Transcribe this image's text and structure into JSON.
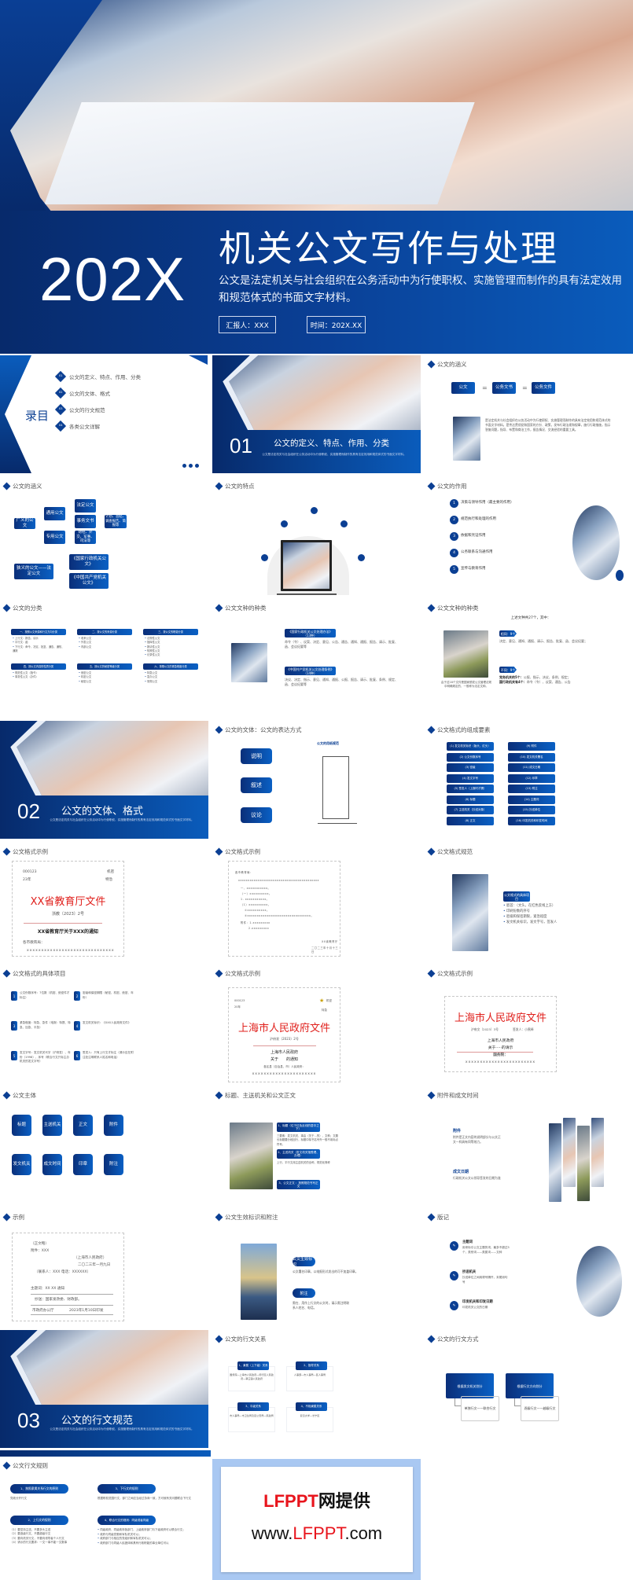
{
  "hero": {
    "year": "202X",
    "title": "机关公文写作与处理",
    "desc": "公文是法定机关与社会组织在公务活动中为行使职权、实施管理而制作的具有法定效用和规范体式的书面文字材料。",
    "reporter": "汇报人：XXX",
    "time": "时间：202X.XX"
  },
  "s": {
    "1": {
      "title": "录目",
      "items": [
        {
          "n": "01",
          "t": "公文的定义、特点、作用、分类"
        },
        {
          "n": "02",
          "t": "公文的文体、格式"
        },
        {
          "n": "03",
          "t": "公文的行文规范"
        },
        {
          "n": "04",
          "t": "各类公文详解"
        }
      ]
    },
    "2": {
      "num": "01",
      "title": "公文的定义、特点、作用、分类",
      "desc": "公文是法定机关与社会组织在公务活动中为行使职权、实施管理而制作的具有法定效用和规范体式的书面文字材料。"
    },
    "3": {
      "hd": "公文的涵义",
      "eq": [
        "公文",
        "公务文书",
        "公务文件"
      ],
      "sign": "=",
      "para": "是法定机关与社会组织在公务活动中为行使职权、实施管理而制作的具有法定效用和规范体式的书面文字材料。是传达贯彻党和国家的方针、政策，发布行政法规和规章，施行行政措施，指示答复问题，指导、布置和商洽工作，报告情况、交流经验的重要工具。"
    },
    "4": {
      "hd": "公文的涵义",
      "b": [
        "广义的公文",
        "通用公文",
        "专用公文",
        "法定公文",
        "事务文书",
        "财经、外交、军事、司法等",
        "计划、总结、调查报告、简报等",
        "狭义的公文——法定公文",
        "《国家行政机关公文》",
        "《中国共产党机关公文》"
      ]
    },
    "5": {
      "hd": "公文的特点"
    },
    "6": {
      "hd": "公文的作用",
      "items": [
        "决策与领导作用（最主要的作用）",
        "规范执行和处理的作用",
        "依据和凭证作用",
        "公务联系与沟通作用",
        "宣传与教育作用"
      ]
    },
    "7": {
      "hd": "公文的分类",
      "g": [
        {
          "t": "一、按照公文来源和行文方向分类",
          "i": [
            "上行文：报告、请示",
            "平行文：函",
            "下行文：命令、决定、批复、通告、通知、通报"
          ]
        },
        {
          "t": "二、按公文的来源分类",
          "i": [
            "收来公文",
            "外发公文",
            "内部公文"
          ]
        },
        {
          "t": "三、按公文的职能分类",
          "i": [
            "法规性公文",
            "指挥性公文",
            "报请性公文",
            "知照性公文",
            "记录性公文"
          ]
        },
        {
          "t": "四、按公文内容的性质分类",
          "i": [
            "规范性公文（指令）",
            "事务性公文（办件）"
          ]
        },
        {
          "t": "五、按公文的秘密等级分类",
          "i": [
            "绝密公文",
            "机密公文",
            "秘密公文"
          ]
        },
        {
          "t": "六、按照公文的紧急程度分类",
          "i": [
            "特急公文",
            "急办公文",
            "常规公文"
          ]
        }
      ]
    },
    "8": {
      "hd": "公文文种的种类",
      "a": "《国家行政机关公文处理办法》（13种）",
      "at": "命令（令）、议案、决定、意见、公告、通告、通知、通报、报告、请示、批复、函、会议纪要等",
      "b": "《中国共产党机关公文处理条例》（14种）",
      "bt": "决议、决定、指示、意见、通知、通报、公报、报告、请示、批复、条例、规定、函、会议纪要等"
    },
    "9": {
      "hd": "公文文种的种类",
      "top": "上述文种共27个，其中：",
      "cap": "由于这18个文件是国家颁发公文管理法规中明确规定的，一般称为法定文种。",
      "t1": "相同：9个",
      "x1": "决定、意见、通知、通报、请示、报告、批复、函、会议纪要；",
      "t2": "不同：9个",
      "x2a": "党务机关的5个：",
      "x2b": "公报、指示、决议、条例、规定；",
      "x2c": "国行政机关有4个：",
      "x2d": "命令（令）、议案、通告、公告"
    },
    "10": {
      "num": "02",
      "title": "公文的文体、格式",
      "desc": "公文是法定机关与社会组织在公务活动中为行使职权、实施管理而制作的具有法定效用和规范体式的书面文字材料。"
    },
    "11": {
      "hd": "公文的文体：公文的表达方式",
      "p": [
        "说明",
        "叙述",
        "议论"
      ],
      "dt": "公文的用纸规范"
    },
    "12": {
      "hd": "公文格式的组成要素",
      "i": [
        "(1) 发文机关标识（版头、红头）",
        "(2) 公文份数序号",
        "(3) 密级",
        "(4) 发文字号",
        "(5) 签发人（上报时才需）",
        "(6) 标题",
        "(7) 主送机关（抄送对象）",
        "(8) 正文",
        "(9) 附件",
        "(10) 发文机关署名",
        "(11) 成文日期",
        "(12) 印章",
        "(13) 附注",
        "(14) 主题词",
        "(15) 抄送单位",
        "(16) 印发机关和印发时间"
      ]
    },
    "13": {
      "hd": "公文格式示例",
      "no": "000123",
      "yr": "23年",
      "sec": "机密",
      "urg": "特急",
      "red": "XX省教育厅文件",
      "code": "浙教〔2023〕2号",
      "title": "XX省教育厅关于XXX的通知",
      "to": "各市教育局：",
      "dots": "xxxxxxxxxxxxxxxxxxxxxxxxxxxxxx"
    },
    "14": {
      "hd": "公文格式示例",
      "l": [
        "各市教育局：",
        "xxxxxxxxxxxxxxxxxxxxxxxxxxxxxxxxxxxxxxxxxx",
        "一、xxxxxxxxxxx。",
        "（一）xxxxxxxxxx。",
        "1. xxxxxxxxxxx。",
        "（1）xxxxxxxxxx。",
        "①xxxxxxxxxx。",
        "②xxxxxxxxxxxxxxxxxxxxxxxxxxxxxxxxx。",
        "附件：1.xxxxxxxxx",
        "2.xxxxxxxxx",
        "XX省教育厅",
        "二〇二三年十月十三日"
      ]
    },
    "15": {
      "hd": "公文格式规范",
      "tag": "公文格式的具体项目",
      "i": [
        "眉首：（文头，在红色反线上方）",
        "印刷份数的序号",
        "密级和保密期限，紧急程度",
        "发文机关标识，发文字号，签发人"
      ]
    },
    "16": {
      "hd": "公文格式的具体项目",
      "i": [
        "公文份数序号：7位数（机密、绝密件才标注）",
        "密级和保密期限（秘密、机密、绝密、年份）",
        "紧急程度：特急、急件（电报：特提、特急、加急、平急）",
        "发文机关标识：《XXX人民政府文件》",
        "发文字号：发文机关代字（沪府发）、年份（1998）、序号（联合行文只标主办机关的发文字号）",
        "签发人：只有上行文才标注（请示应在附注处注明联系人姓名和电话）"
      ],
      "n": [
        "1",
        "2",
        "3",
        "4",
        "5",
        "6"
      ]
    },
    "17": {
      "hd": "公文格式示例",
      "no": "000123",
      "yr": "20年",
      "sec": "机密",
      "urg": "特急",
      "red": "上海市人民政府文件",
      "code": "沪府发〔2023〕2号",
      "org": "上海市人民政府",
      "about": "关于　　的通知",
      "to": "各区县（自治县、市）人民政府：",
      "dots": "xxxxxxxxxxxxxxxxxxxxxx"
    },
    "18": {
      "hd": "公文格式示例",
      "red": "上海市人民政府文件",
      "code": "沪府文〔2023〕3号",
      "sign": "签发人：小黑绎",
      "org": "上海市人民政府",
      "about": "关于·····的请示",
      "to": "国务院：",
      "dots": "xxxxxxxxxxxxxxxxxxxxxxxx"
    },
    "19": {
      "hd": "公文主体",
      "b": [
        "标题",
        "主送机关",
        "正文",
        "附件",
        "发文机关",
        "成文时间",
        "印章",
        "附注"
      ]
    },
    "20": {
      "hd": "标题、主送机关和公文正文",
      "t1": "1、标题（位于红色反线的居中之下）",
      "x1": "三要素：发文机关、事由（关于…的）、文种；文题长标题要分段回行，标题中除书名号外一般不用标点符号。",
      "t2": "2、主送机关（发文机关指受理、办理）",
      "x2": "上行、平行文用主送机关的全称、规范化简称",
      "t3": "3、公文正文 ：按照规范书写正文"
    },
    "21": {
      "hd": "附件和成文时间",
      "t1": "附件",
      "x1": "附件是正文内容的说明部分与公文正文一样具有同等效力。",
      "t2": "成文日期",
      "x2": "行政机关公文以领导签发的日期为准"
    },
    "22": {
      "hd": "示例",
      "l": [
        "（正文略）",
        "附件：XXX",
        "（上海市人民政府）",
        "二〇二三年一月九日",
        "（联系人：XXX 电话：XXXXXX）",
        "主题词：XX XX 通知",
        "抄送：国家发改委、财政部。",
        "市政府办公厅",
        "2023年1月10日印发"
      ]
    },
    "23": {
      "hd": "公文生效标识和附注",
      "p1": "公文生效标识",
      "x1": "公文署名印章，以电报形式发出的可不加盖印章。",
      "p2": "附注",
      "x2": "需在、用作上行文的公文时，请示需注明联系人姓名、电话。"
    },
    "24": {
      "hd": "版记",
      "i": [
        {
          "t": "主题词",
          "x": "用来标引公文主题的词，最多不超过5个，类别词——类属词——文种"
        },
        {
          "t": "抄送机关",
          "x": "抄送单位之间用顿号隔开，末尾用句号"
        },
        {
          "t": "印发机关和印发日期",
          "x": "印发机关公文的日期"
        }
      ]
    },
    "25": {
      "num": "03",
      "title": "公文的行文规范",
      "desc": "公文是法定机关与社会组织在公务活动中为行使职权、实施管理而制作的具有法定效用和规范体式的书面文字材料。"
    },
    "26": {
      "hd": "公文的行文关系",
      "i": [
        {
          "t": "1、隶属（上下级）关系",
          "x": "国务院—上海市人民政府—闵行区人民政府—莘庄镇人民政府"
        },
        {
          "t": "2、指导关系",
          "x": "人事部—市人事局—区人事局"
        },
        {
          "t": "3、平级关系",
          "x": "市人事局—市卫生局及区公安局—民政局"
        },
        {
          "t": "4、不相隶属关系",
          "x": "复旦大学—长宁区"
        }
      ]
    },
    "27": {
      "hd": "公文的行文方式",
      "a": "根据发文机关划分",
      "ax": "单独行文——联合行文",
      "b": "根据行文方向划分",
      "bx": "逐级行文——越级行文"
    },
    "28": {
      "hd": "公文行文规则",
      "t1": "1、按照隶属关系行文的原则",
      "x1": "党政分开行文",
      "t2": "2、上行文的规则",
      "l2": [
        "（1）要坚持主送，不要多头主送",
        "（2）要逐级行文，不要越级行文",
        "（3）要向机关行文，不要向领导者个人行文",
        "（4）请示的行文要求：一文一事不能一文数事"
      ],
      "t3": "3、下行文的规则",
      "x3": "根据职权范围行文，部门之间应当经过协商一致，方可就有关问题联合下行文",
      "t4": "4、联合行文的规则：同级或者同级",
      "l4": [
        "同级政府、同级政府各部门、上级政府部门与下级政府可以联合行文；",
        "政府与同级党委和军队机关可以；",
        "政府部门与相应的党组织和军队机关可以；",
        "政府部门与同级人民团体和具有行政职能的事业单位可以"
      ]
    },
    "29": {
      "l1a": "LFPPT",
      "l1b": "网提供",
      "l2a": "www.",
      "l2b": "LFPPT",
      "l2c": ".com"
    }
  },
  "colors": {
    "brand_dark": "#072a6b",
    "brand": "#0a5cbc",
    "red": "#e0201c",
    "watermark_border": "#a9c8f2"
  }
}
